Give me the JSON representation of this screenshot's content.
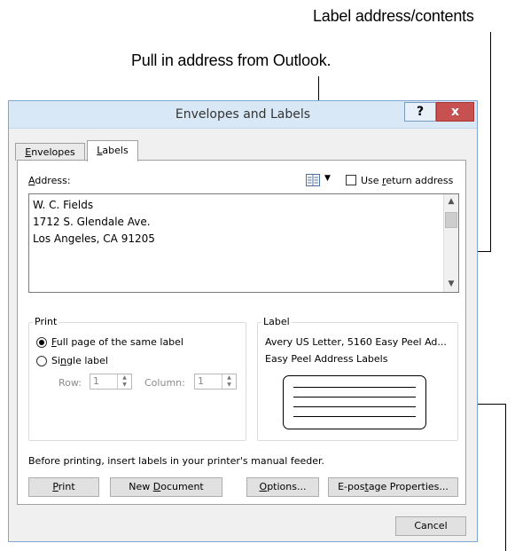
{
  "callouts": {
    "label_contents": "Label address/contents",
    "outlook": "Pull in address from Outlook."
  },
  "dialog": {
    "title": "Envelopes and Labels",
    "help_label": "?",
    "close_label": "x",
    "tabs": {
      "envelopes": {
        "prefix": "",
        "key": "E",
        "rest": "nvelopes"
      },
      "labels": {
        "prefix": "",
        "key": "L",
        "rest": "abels"
      }
    },
    "address": {
      "label_key": "A",
      "label_rest": "ddress:",
      "lines": [
        "W. C. Fields",
        "1712 S. Glendale Ave.",
        "Los Angeles, CA 91205"
      ]
    },
    "use_return_address": {
      "prefix": "Use ",
      "key": "r",
      "rest": "eturn address",
      "checked": false
    },
    "address_book_icon": "address-book-icon",
    "print_group": {
      "title": "Print",
      "full_page": {
        "key": "F",
        "rest": "ull page of the same label",
        "selected": true
      },
      "single_label": {
        "prefix": "Si",
        "key": "n",
        "rest": "gle label",
        "selected": false
      },
      "row_label": "Row:",
      "row_value": "1",
      "column_label": "Column:",
      "column_value": "1"
    },
    "label_group": {
      "title": "Label",
      "product": "Avery US Letter, 5160 Easy Peel Ad...",
      "description": "Easy Peel Address Labels"
    },
    "feeder_note": "Before printing, insert labels in your printer's manual feeder.",
    "buttons": {
      "print": {
        "prefix": "",
        "key": "P",
        "rest": "rint"
      },
      "new_document": {
        "prefix": "New ",
        "key": "D",
        "rest": "ocument"
      },
      "options": {
        "prefix": "",
        "key": "O",
        "rest": "ptions..."
      },
      "epostage": {
        "prefix": "E-pos",
        "key": "t",
        "rest": "age Properties..."
      },
      "cancel": "Cancel"
    }
  },
  "colors": {
    "titlebar": "#d9e8f6",
    "close_button": "#c75050",
    "dialog_border": "#7fa7cf"
  }
}
